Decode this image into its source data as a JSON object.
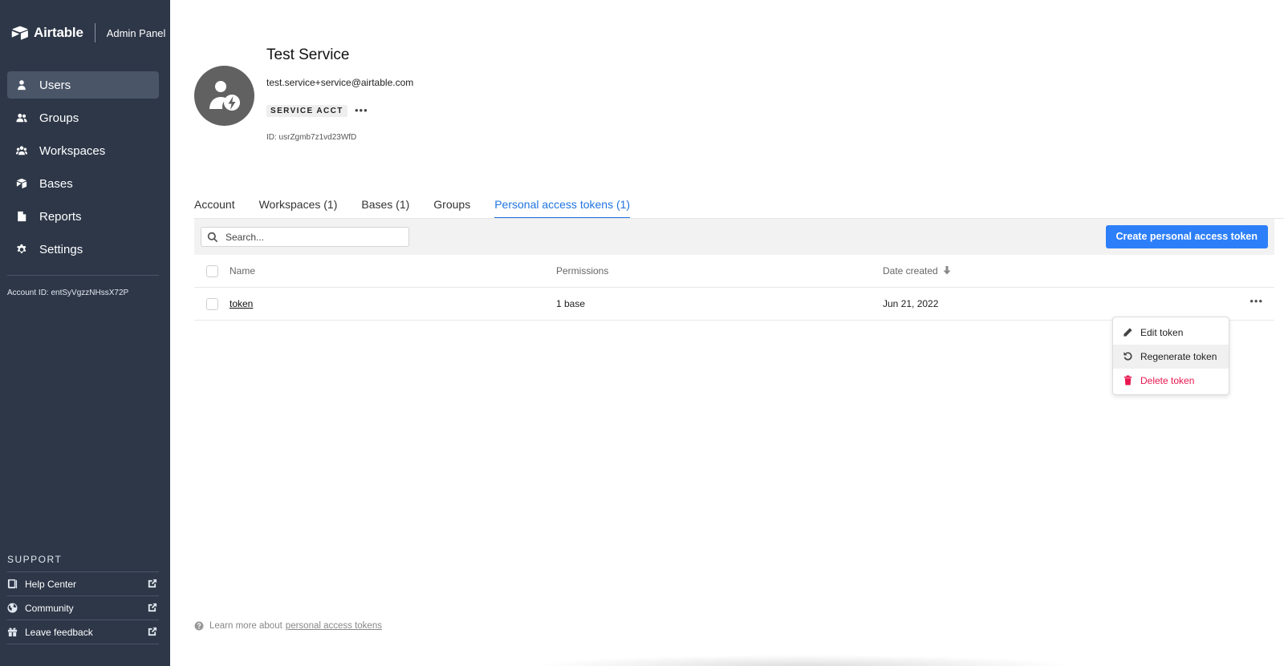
{
  "brand": {
    "name": "Airtable",
    "panel": "Admin Panel"
  },
  "sidebar": {
    "items": [
      {
        "label": "Users",
        "icon": "user-icon",
        "active": true
      },
      {
        "label": "Groups",
        "icon": "group-icon"
      },
      {
        "label": "Workspaces",
        "icon": "workspaces-icon"
      },
      {
        "label": "Bases",
        "icon": "bases-icon"
      },
      {
        "label": "Reports",
        "icon": "reports-icon"
      },
      {
        "label": "Settings",
        "icon": "gear-icon"
      }
    ],
    "account_id": "Account ID: entSyVgzzNHssX72P",
    "support": {
      "heading": "SUPPORT",
      "items": [
        {
          "label": "Help Center",
          "icon": "book-icon"
        },
        {
          "label": "Community",
          "icon": "globe-icon"
        },
        {
          "label": "Leave feedback",
          "icon": "gift-icon"
        }
      ]
    }
  },
  "user": {
    "name": "Test Service",
    "email": "test.service+service@airtable.com",
    "badge": "SERVICE ACCT",
    "more": "•••",
    "id": "ID: usrZgmb7z1vd23WfD"
  },
  "tabs": [
    {
      "label": "Account"
    },
    {
      "label": "Workspaces (1)"
    },
    {
      "label": "Bases (1)"
    },
    {
      "label": "Groups"
    },
    {
      "label": "Personal access tokens (1)",
      "active": true
    }
  ],
  "toolbar": {
    "search_placeholder": "Search...",
    "create_label": "Create personal access token"
  },
  "table": {
    "headers": {
      "name": "Name",
      "permissions": "Permissions",
      "date": "Date created"
    },
    "rows": [
      {
        "name": "token",
        "permissions": "1 base",
        "date": "Jun 21, 2022",
        "more": "•••"
      }
    ]
  },
  "menu": {
    "items": [
      {
        "label": "Edit token",
        "icon": "pencil-icon"
      },
      {
        "label": "Regenerate token",
        "icon": "refresh-icon",
        "hover": true
      },
      {
        "label": "Delete token",
        "icon": "trash-icon",
        "danger": true
      }
    ]
  },
  "footer": {
    "learn_prefix": "Learn more about",
    "learn_link": "personal access tokens"
  },
  "colors": {
    "sidebar_bg": "#2d3748",
    "accent": "#2d7ff9",
    "tab_active": "#1f74e0",
    "danger": "#e8174f"
  }
}
